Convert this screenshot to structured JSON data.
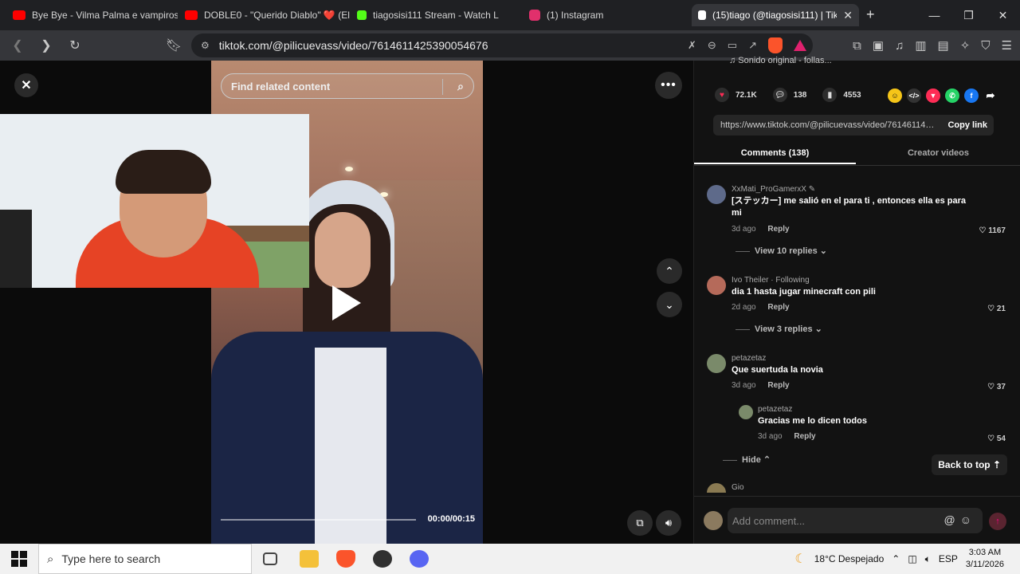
{
  "browser": {
    "tabs": [
      {
        "title": "Bye Bye - Vilma Palma e vampiros",
        "icon": "youtube-icon",
        "color": "#ff0000",
        "active": false
      },
      {
        "title": "DOBLE0 - \"Querido Diablo\" ❤️ (El",
        "icon": "youtube-icon",
        "color": "#ff0000",
        "active": false
      },
      {
        "title": "tiagosisi111 Stream - Watch L",
        "icon": "kick-icon",
        "color": "#53fc18",
        "active": false
      },
      {
        "title": "(1) Instagram",
        "icon": "instagram-icon",
        "color": "#e1306c",
        "active": false
      },
      {
        "title": "(15)tiago (@tiagosisi111) | Tik",
        "icon": "tiktok-icon",
        "color": "#ffffff",
        "active": true
      }
    ],
    "address": "tiktok.com/@pilicuevass/video/7614611425390054676"
  },
  "video": {
    "search_placeholder": "Find related content",
    "time": "00:00/00:15",
    "progress": 0
  },
  "panel": {
    "music": "♫ Sonido original - follas...",
    "likes": "72.1K",
    "comments_count": "138",
    "saves": "4553",
    "link_url": "https://www.tiktok.com/@pilicuevass/video/7614611425390054676",
    "copy_label": "Copy link",
    "tab_comments": "Comments (138)",
    "tab_creator": "Creator videos",
    "back_to_top": "Back to top ⇡",
    "add_comment_placeholder": "Add comment..."
  },
  "comments": [
    {
      "user": "XxMati_ProGamerxX ✎",
      "text": "[ステッカー] me salió en el para ti , entonces ella es para mi",
      "age": "3d ago",
      "reply": "Reply",
      "likes": "1167",
      "view": "View 10 replies ⌄"
    },
    {
      "user": "Ivo Theiler · Following",
      "text": "dia 1 hasta jugar minecraft con pili",
      "age": "2d ago",
      "reply": "Reply",
      "likes": "21",
      "view": "View 3 replies ⌄"
    },
    {
      "user": "petazetaz",
      "text": "Que suertuda la novia",
      "age": "3d ago",
      "reply": "Reply",
      "likes": "37"
    },
    {
      "user": "petazetaz",
      "text": "Gracias me lo dicen todos",
      "age": "3d ago",
      "reply": "Reply",
      "likes": "54",
      "hide": "Hide ⌃"
    },
    {
      "user": "Gio"
    }
  ],
  "taskbar": {
    "search_placeholder": "Type here to search",
    "weather": "18°C  Despejado",
    "lang": "ESP",
    "time": "3:03 AM",
    "date": "3/11/2026"
  }
}
